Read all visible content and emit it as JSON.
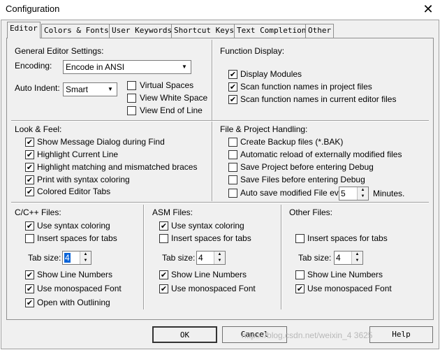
{
  "window": {
    "title": "Configuration"
  },
  "tabs": [
    "Editor",
    "Colors & Fonts",
    "User Keywords",
    "Shortcut Keys",
    "Text Completion",
    "Other"
  ],
  "general": {
    "title": "General Editor Settings:",
    "encoding_label": "Encoding:",
    "encoding_value": "Encode in ANSI",
    "auto_indent_label": "Auto Indent:",
    "auto_indent_value": "Smart",
    "virtual_spaces": "Virtual Spaces",
    "view_white_space": "View White Space",
    "view_end_of_line": "View End of Line"
  },
  "function_display": {
    "title": "Function Display:",
    "items": [
      "Display Modules",
      "Scan function names in project files",
      "Scan function names in current editor files"
    ]
  },
  "look_feel": {
    "title": "Look & Feel:",
    "items": [
      "Show Message Dialog during Find",
      "Highlight Current Line",
      "Highlight matching and mismatched braces",
      "Print with syntax coloring",
      "Colored Editor Tabs"
    ]
  },
  "file_project": {
    "title": "File & Project Handling:",
    "items": [
      "Create Backup files (*.BAK)",
      "Automatic reload of externally modified files",
      "Save Project before entering Debug",
      "Save Files before entering Debug",
      "Auto save modified File every"
    ],
    "autosave_value": "5",
    "minutes_label": "Minutes."
  },
  "cpp": {
    "title": "C/C++ Files:",
    "syntax": "Use syntax coloring",
    "insert_spaces": "Insert spaces for tabs",
    "tab_size_label": "Tab size:",
    "tab_size_value": "4",
    "line_numbers": "Show Line Numbers",
    "monospaced": "Use monospaced Font",
    "outlining": "Open with Outlining"
  },
  "asm": {
    "title": "ASM Files:",
    "syntax": "Use syntax coloring",
    "insert_spaces": "Insert spaces for tabs",
    "tab_size_label": "Tab size:",
    "tab_size_value": "4",
    "line_numbers": "Show Line Numbers",
    "monospaced": "Use monospaced Font"
  },
  "other_files": {
    "title": "Other Files:",
    "insert_spaces": "Insert spaces for tabs",
    "tab_size_label": "Tab size:",
    "tab_size_value": "4",
    "line_numbers": "Show Line Numbers",
    "monospaced": "Use monospaced Font"
  },
  "buttons": {
    "ok": "OK",
    "cancel": "Cancel",
    "help": "Help"
  },
  "watermark": "https://blog.csdn.net/weixin_4  3625",
  "check_mark": "✔"
}
